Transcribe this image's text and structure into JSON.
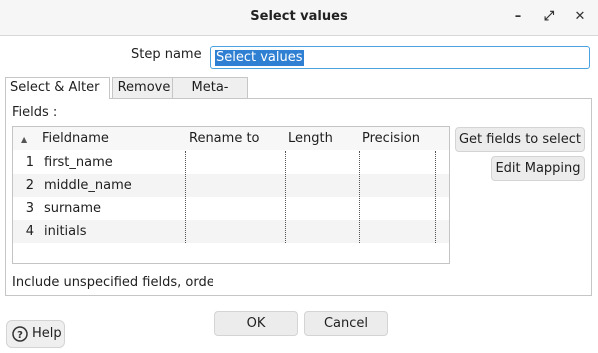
{
  "window": {
    "title": "Select values",
    "minimize_glyph": "–",
    "maximize_glyph": "⤢",
    "close_glyph": "✕"
  },
  "step": {
    "label": "Step name",
    "value": "Select values"
  },
  "tabs": [
    {
      "label": "Select & Alter",
      "active": true
    },
    {
      "label": "Remove",
      "active": false
    },
    {
      "label": "Meta-data",
      "active": false
    }
  ],
  "fields": {
    "label": "Fields :",
    "columns": [
      "Fieldname",
      "Rename to",
      "Length",
      "Precision"
    ],
    "rows": [
      {
        "num": "1",
        "fieldname": "first_name"
      },
      {
        "num": "2",
        "fieldname": "middle_name"
      },
      {
        "num": "3",
        "fieldname": "surname"
      },
      {
        "num": "4",
        "fieldname": "initials"
      }
    ]
  },
  "side_buttons": {
    "get_fields": "Get fields to select",
    "edit_mapping": "Edit Mapping"
  },
  "include_label": "Include unspecified fields, order",
  "footer": {
    "ok": "OK",
    "cancel": "Cancel",
    "help": "Help"
  },
  "colors": {
    "selection": "#2f7fd2",
    "focus_border": "#4aa3df"
  }
}
